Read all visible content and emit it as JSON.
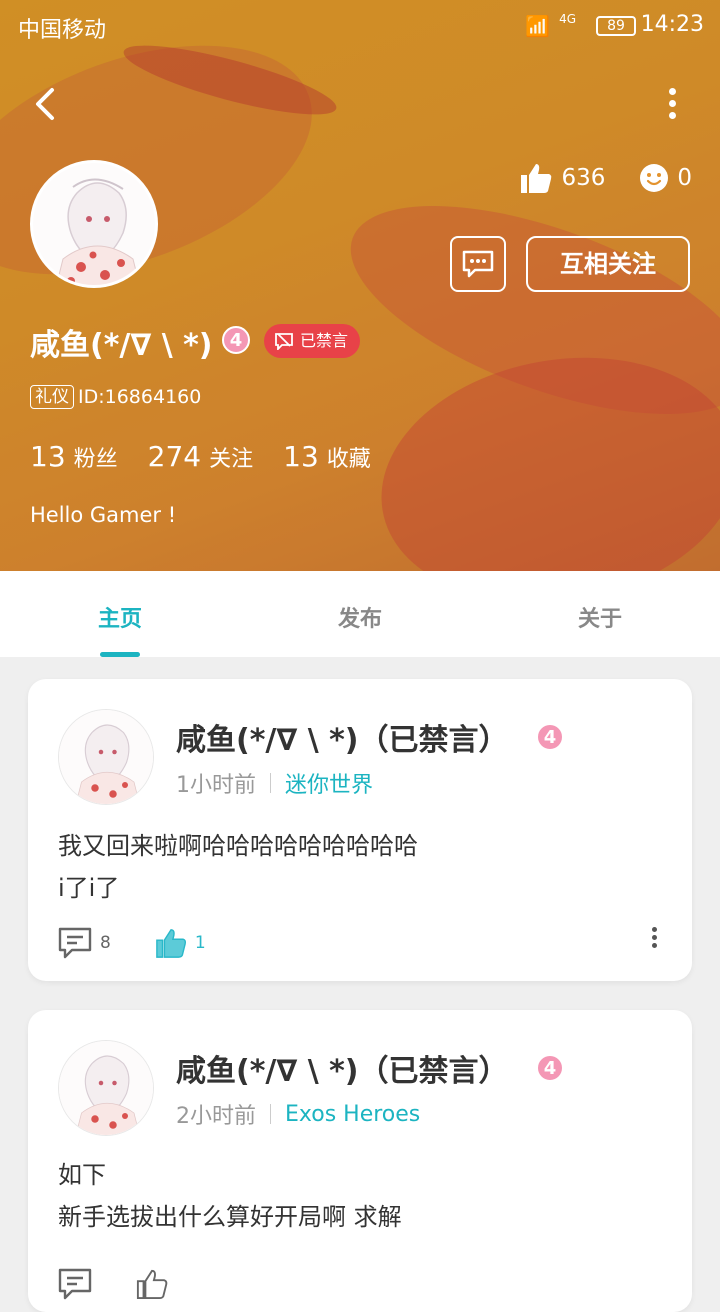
{
  "status_bar": {
    "carrier": "中国移动",
    "battery": "89",
    "time": "14:23",
    "network": "4G"
  },
  "profile": {
    "name": "咸鱼(*/∇ \\ *)",
    "level": "4",
    "banned_label": "已禁言",
    "id_tag": "礼仪",
    "id_text": "ID:16864160",
    "likes": "636",
    "smiles": "0",
    "follow_button": "互相关注",
    "fans_count": "13",
    "fans_label": "粉丝",
    "following_count": "274",
    "following_label": "关注",
    "favorites_count": "13",
    "favorites_label": "收藏",
    "bio": "Hello Gamer !"
  },
  "tabs": [
    "主页",
    "发布",
    "关于"
  ],
  "posts": [
    {
      "author": "咸鱼(*/∇ \\ *)（已禁言）",
      "level": "4",
      "time": "1小时前",
      "game": "迷你世界",
      "line1": "我又回来啦啊哈哈哈哈哈哈哈哈哈",
      "line2": "i了i了",
      "comments": "8",
      "likes": "1"
    },
    {
      "author": "咸鱼(*/∇ \\ *)（已禁言）",
      "level": "4",
      "time": "2小时前",
      "game": "Exos Heroes",
      "line1": "如下",
      "line2": "新手选拔出什么算好开局啊 求解",
      "comments": "",
      "likes": ""
    }
  ]
}
